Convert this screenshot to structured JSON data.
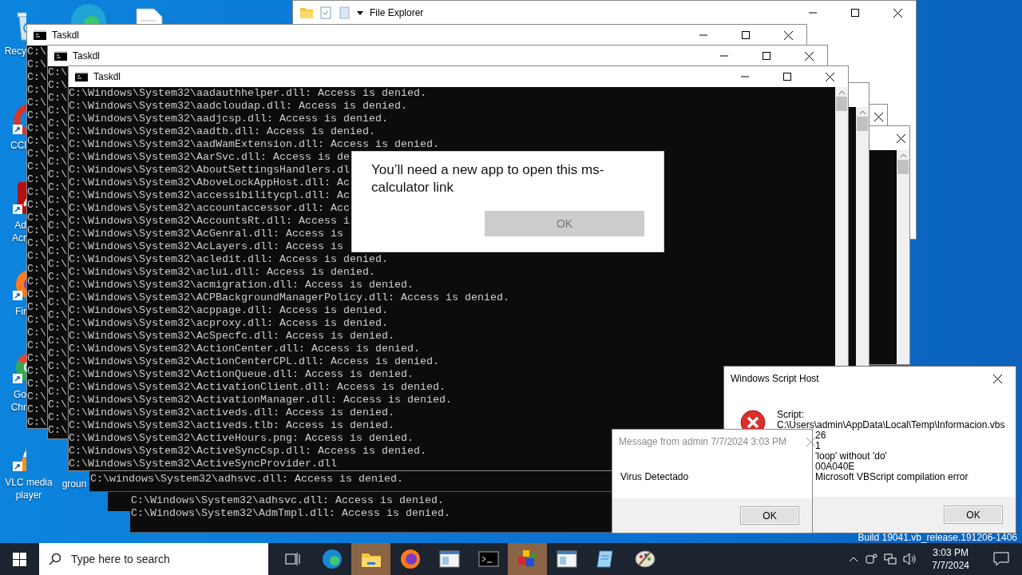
{
  "desktop_icons": [
    {
      "kind": "recycle",
      "lines": [
        "Recy"
      ]
    },
    {
      "kind": "ccleaner",
      "lines": [
        "CCl"
      ]
    },
    {
      "kind": "acrobat",
      "lines": [
        "Ad",
        "Acr"
      ]
    },
    {
      "kind": "firefox",
      "lines": [
        "Fir"
      ]
    },
    {
      "kind": "chrome",
      "lines": [
        "Go",
        "Chr"
      ]
    },
    {
      "kind": "vlc",
      "lines": [
        "VLC media",
        "player"
      ]
    },
    {
      "kind": "blank",
      "lines": [
        "groun"
      ]
    }
  ],
  "peek_icons": [
    {
      "kind": "edge"
    },
    {
      "kind": "file"
    }
  ],
  "explorer": {
    "title": "File Explorer"
  },
  "consoles": [
    {
      "title": "Taskdl",
      "lines": [
        "C:\\",
        "C:\\",
        "C:\\",
        "C:\\",
        "C:\\",
        "C:\\",
        "C:\\",
        "C:\\",
        "C:\\",
        "C:\\",
        "C:\\",
        "C:\\",
        "C:\\",
        "C:\\",
        "C:\\",
        "C:\\",
        "C:\\",
        "C:\\",
        "C:\\",
        "C:\\",
        "C:\\",
        "C:\\",
        "C:\\",
        "C:\\",
        "C:\\",
        "C:\\",
        "C:\\",
        "C:\\",
        "C:\\",
        "C:\\"
      ]
    },
    {
      "title": "Taskdl",
      "lines": [
        "C:\\",
        "C:\\",
        "C:\\",
        "C:\\",
        "C:\\",
        "C:\\",
        "C:\\",
        "C:\\",
        "C:\\",
        "C:\\",
        "C:\\",
        "C:\\",
        "C:\\",
        "C:\\",
        "C:\\",
        "C:\\",
        "C:\\",
        "C:\\",
        "C:\\",
        "C:\\",
        "C:\\",
        "C:\\",
        "C:\\",
        "C:\\",
        "C:\\",
        "C:\\",
        "C:\\",
        "C:\\",
        "C:\\"
      ]
    },
    {
      "title": "Taskdl",
      "lines": [
        "C:\\Windows\\System32\\aadauthhelper.dll: Access is denied.",
        "C:\\Windows\\System32\\aadcloudap.dll: Access is denied.",
        "C:\\Windows\\System32\\aadjcsp.dll: Access is denied.",
        "C:\\Windows\\System32\\aadtb.dll: Access is denied.",
        "C:\\Windows\\System32\\aadWamExtension.dll: Access is denied.",
        "C:\\Windows\\System32\\AarSvc.dll: Access is de",
        "C:\\Windows\\System32\\AboutSettingsHandlers.dl",
        "C:\\Windows\\System32\\AboveLockAppHost.dll: Ac",
        "C:\\Windows\\System32\\accessibilitycpl.dll: Ac",
        "C:\\Windows\\System32\\accountaccessor.dll: Acc",
        "C:\\Windows\\System32\\AccountsRt.dll: Access i",
        "C:\\Windows\\System32\\AcGenral.dll: Access is",
        "C:\\Windows\\System32\\AcLayers.dll: Access is",
        "C:\\Windows\\System32\\acledit.dll: Access is denied.",
        "C:\\Windows\\System32\\aclui.dll: Access is denied.",
        "C:\\Windows\\System32\\acmigration.dll: Access is denied.",
        "C:\\Windows\\System32\\ACPBackgroundManagerPolicy.dll: Access is denied.",
        "C:\\Windows\\System32\\acppage.dll: Access is denied.",
        "C:\\Windows\\System32\\acproxy.dll: Access is denied.",
        "C:\\Windows\\System32\\AcSpecfc.dll: Access is denied.",
        "C:\\Windows\\System32\\ActionCenter.dll: Access is denied.",
        "C:\\Windows\\System32\\ActionCenterCPL.dll: Access is denied.",
        "C:\\Windows\\System32\\ActionQueue.dll: Access is denied.",
        "C:\\Windows\\System32\\ActivationClient.dll: Access is denied.",
        "C:\\Windows\\System32\\ActivationManager.dll: Access is denied.",
        "C:\\Windows\\System32\\activeds.dll: Access is denied.",
        "C:\\Windows\\System32\\activeds.tlb: Access is denied.",
        "C:\\Windows\\System32\\ActiveHours.png: Access is denied.",
        "C:\\Windows\\System32\\ActiveSyncCsp.dll: Access is denied.",
        "C:\\Windows\\System32\\ActiveSyncProvider.dll"
      ]
    }
  ],
  "bottom_consoles": [
    {
      "lines": [
        "C:\\windows\\System32\\adhsvc.dll: Access is denied."
      ]
    },
    {
      "lines": [
        "C:\\Windows\\System32\\adhsvc.dll: Access is denied.",
        "C:\\Windows\\System32\\AdmTmpl.dll: Access is denied."
      ]
    }
  ],
  "app_dialog": {
    "message": "You’ll need a new app to open this ms-calculator link",
    "button": "OK"
  },
  "script_host": {
    "title": "Windows Script Host",
    "lines": [
      "Script:",
      "C:\\Users\\admin\\AppData\\Local\\Temp\\Informacion.vbs"
    ],
    "values": [
      "26",
      "1",
      "'loop' without 'do'",
      "00A040E",
      "Microsoft VBScript compilation error"
    ],
    "button": "OK"
  },
  "message_box": {
    "title": "Message from admin 7/7/2024 3:03 PM",
    "message": "Virus Detectado",
    "button": "OK"
  },
  "build_text": "Build 19041.vb_release.191206-1406",
  "taskbar": {
    "search": {
      "placeholder": "Type here to search"
    },
    "apps": [
      {
        "kind": "taskview",
        "active": false
      },
      {
        "kind": "edge",
        "active": false
      },
      {
        "kind": "folder",
        "active": true
      },
      {
        "kind": "firefox",
        "active": false
      },
      {
        "kind": "window",
        "active": false
      },
      {
        "kind": "terminal",
        "active": false
      },
      {
        "kind": "blocks",
        "active": true
      },
      {
        "kind": "window",
        "active": false
      },
      {
        "kind": "notepad",
        "active": false
      },
      {
        "kind": "palette",
        "active": false
      }
    ],
    "time": "3:03 PM",
    "date": "7/7/2024"
  }
}
